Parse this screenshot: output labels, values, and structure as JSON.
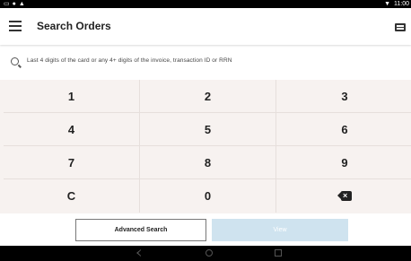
{
  "status_bar": {
    "time": "11:00",
    "left_icons": [
      "sim-icon",
      "alert-shield-icon",
      "warning-icon"
    ],
    "right_icons": [
      "wifi-icon"
    ]
  },
  "app_bar": {
    "title": "Search Orders",
    "menu_icon": "hamburger-menu-icon",
    "action_icon": "card-icon"
  },
  "search": {
    "placeholder": "Last 4 digits of the card or any 4+ digits of the invoice, transaction ID or RRN"
  },
  "keypad": {
    "keys": [
      "1",
      "2",
      "3",
      "4",
      "5",
      "6",
      "7",
      "8",
      "9",
      "C",
      "0"
    ],
    "backspace_icon": "backspace-icon"
  },
  "actions": {
    "advanced_search": "Advanced Search",
    "view": "View"
  },
  "colors": {
    "accent_disabled": "#cfe3ef",
    "keypad_bg": "#f7f2f0"
  }
}
